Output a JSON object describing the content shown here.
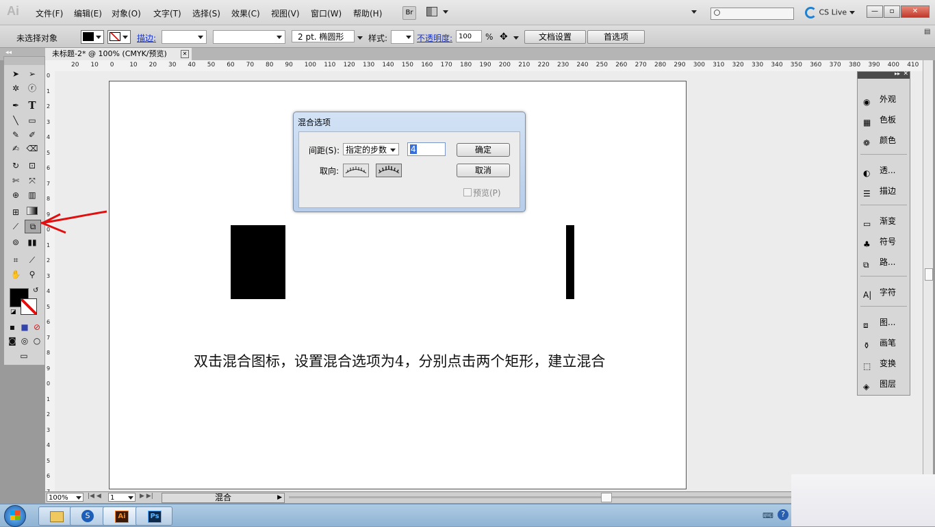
{
  "app": {
    "logo": "Ai"
  },
  "menu": [
    "文件(F)",
    "编辑(E)",
    "对象(O)",
    "文字(T)",
    "选择(S)",
    "效果(C)",
    "视图(V)",
    "窗口(W)",
    "帮助(H)"
  ],
  "appbar": {
    "bridge": "Br",
    "cs_live": "CS Live"
  },
  "control": {
    "selection_status": "未选择对象",
    "stroke_label": "描边:",
    "brush_size": "2 pt. 椭圆形",
    "style_label": "样式:",
    "opacity_label": "不透明度:",
    "opacity_value": "100",
    "percent": "%",
    "doc_setup": "文档设置",
    "preferences": "首选项"
  },
  "document": {
    "tab_title": "未标题-2* @ 100% (CMYK/预览)"
  },
  "ruler": {
    "h_labels": [
      "20",
      "10",
      "0",
      "10",
      "20",
      "30",
      "40",
      "50",
      "60",
      "70",
      "80",
      "90",
      "100",
      "110",
      "120",
      "130",
      "140",
      "150",
      "160",
      "170",
      "180",
      "190",
      "200",
      "210",
      "220",
      "230",
      "240",
      "250",
      "260",
      "270",
      "280",
      "290",
      "300",
      "310",
      "320",
      "330",
      "340",
      "350",
      "360",
      "370",
      "380",
      "390",
      "400",
      "410"
    ],
    "v_labels": [
      "0",
      "1",
      "2",
      "3",
      "4",
      "5",
      "6",
      "7",
      "8",
      "9",
      "0",
      "1",
      "2",
      "3",
      "4",
      "5",
      "6",
      "7",
      "8",
      "9",
      "0",
      "1",
      "2",
      "3",
      "4",
      "5",
      "6",
      "7"
    ]
  },
  "dialog": {
    "title": "混合选项",
    "spacing_label": "间距(S):",
    "spacing_mode": "指定的步数",
    "steps_value": "4",
    "ok": "确定",
    "orientation_label": "取向:",
    "cancel": "取消",
    "preview": "预览(P)"
  },
  "instruction": "双击混合图标，设置混合选项为4，分别点击两个矩形，建立混合",
  "panels": [
    {
      "label": "外观",
      "icon": "appearance-icon"
    },
    {
      "label": "色板",
      "icon": "swatches-icon"
    },
    {
      "label": "颜色",
      "icon": "color-icon"
    },
    {
      "label": "透...",
      "icon": "transparency-icon"
    },
    {
      "label": "描边",
      "icon": "stroke-icon"
    },
    {
      "label": "渐变",
      "icon": "gradient-icon"
    },
    {
      "label": "符号",
      "icon": "symbols-icon"
    },
    {
      "label": "路...",
      "icon": "pathfinder-icon"
    },
    {
      "label": "字符",
      "icon": "character-icon"
    },
    {
      "label": "图...",
      "icon": "graphic-styles-icon"
    },
    {
      "label": "画笔",
      "icon": "brushes-icon"
    },
    {
      "label": "变换",
      "icon": "transform-icon"
    },
    {
      "label": "图层",
      "icon": "layers-icon"
    }
  ],
  "status": {
    "zoom": "100%",
    "page": "1",
    "tool_status": "混合"
  },
  "taskbar": {
    "ai": "Ai",
    "ps": "Ps"
  },
  "colors": {
    "accent_blue": "#1a34c8",
    "annotation_red": "#e01010"
  }
}
